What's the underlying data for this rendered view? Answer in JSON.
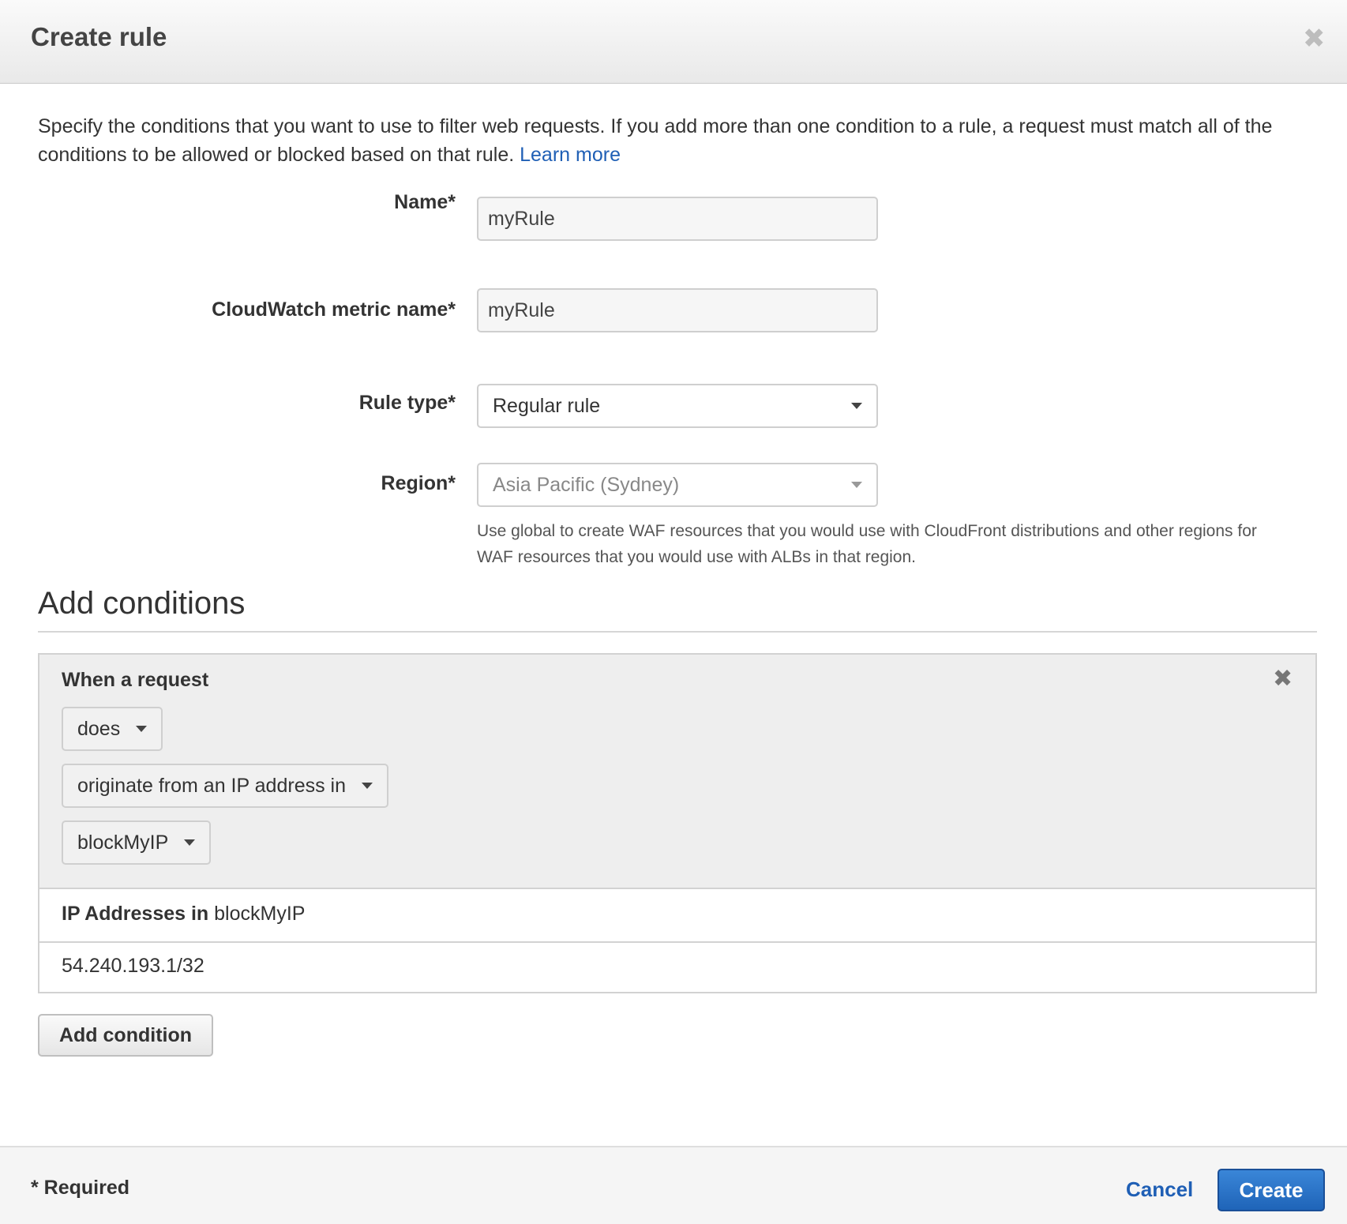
{
  "modal": {
    "title": "Create rule",
    "close_icon": "close-icon"
  },
  "intro": {
    "text": "Specify the conditions that you want to use to filter web requests. If you add more than one condition to a rule, a request must match all of the conditions to be allowed or blocked based on that rule. ",
    "learn_more": "Learn more"
  },
  "form": {
    "name_label": "Name*",
    "name_value": "myRule",
    "metric_label": "CloudWatch metric name*",
    "metric_value": "myRule",
    "rule_type_label": "Rule type*",
    "rule_type_value": "Regular rule",
    "region_label": "Region*",
    "region_value": "Asia Pacific (Sydney)",
    "region_help": "Use global to create WAF resources that you would use with CloudFront distributions and other regions for WAF resources that you would use with ALBs in that region."
  },
  "conditions": {
    "title": "Add conditions",
    "when_label": "When a request",
    "does": "does",
    "match_type": "originate from an IP address in",
    "condition_name": "blockMyIP",
    "ip_header_bold": "IP Addresses in",
    "ip_header_set": " blockMyIP",
    "ip_addresses": [
      "54.240.193.1/32"
    ],
    "add_button": "Add condition"
  },
  "footer": {
    "required": "* Required",
    "cancel": "Cancel",
    "create": "Create"
  },
  "colors": {
    "link": "#1f5fb5",
    "primary_button": "#1f64b8"
  }
}
